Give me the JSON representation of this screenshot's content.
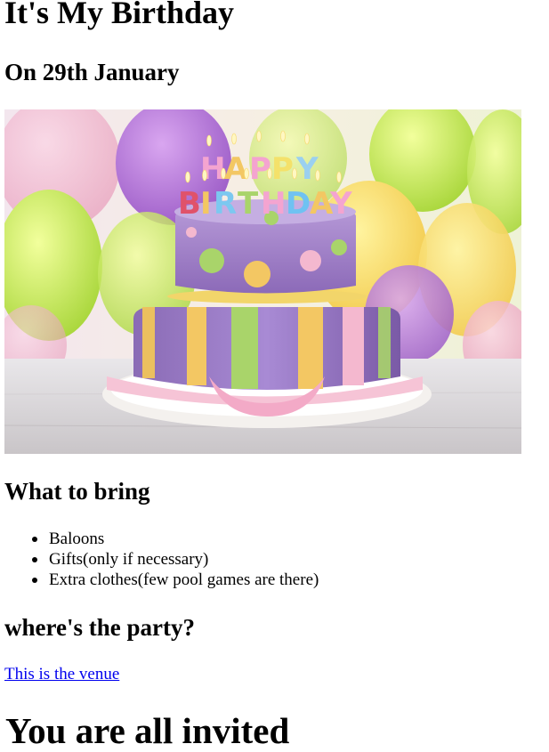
{
  "page": {
    "title": "It's My Birthday",
    "date_line": "On 29th January"
  },
  "photo": {
    "candles_top": "HAPPY",
    "candles_bottom": "BIRTHDAY"
  },
  "bring": {
    "heading": "What to bring",
    "items": [
      "Baloons",
      "Gifts(only if necessary)",
      "Extra clothes(few pool games are there)"
    ]
  },
  "party": {
    "heading": "where's the party?",
    "venue_link": "This is the venue"
  },
  "footer": {
    "invite": "You are all invited"
  },
  "colors": {
    "link": "#0000ee",
    "text": "#000000"
  }
}
